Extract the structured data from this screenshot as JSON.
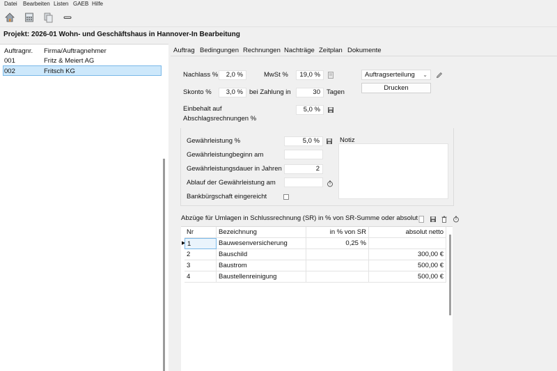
{
  "menu": {
    "items": [
      "Datei",
      "Bearbeiten",
      "Listen",
      "GAEB",
      "Hilfe"
    ]
  },
  "toolbar": {
    "icons": [
      "home-icon",
      "calculator-icon",
      "copy-icon",
      "link-icon"
    ]
  },
  "project": {
    "title": "Projekt:  2026-01 Wohn- und Geschäftshaus in Hannover-In Bearbeitung"
  },
  "contractors": {
    "columns": [
      "Auftragnr.",
      "Firma/Auftragnehmer"
    ],
    "rows": [
      {
        "nr": "001",
        "name": "Fritz & Meiert AG"
      },
      {
        "nr": "002",
        "name": "Fritsch KG"
      }
    ]
  },
  "tabs": [
    "Auftrag",
    "Bedingungen",
    "Rechnungen",
    "Nachträge",
    "Zeitplan",
    "Dokumente"
  ],
  "conditions": {
    "nachlass_label": "Nachlass %",
    "nachlass_value": "2,0 %",
    "mwst_label": "MwSt %",
    "mwst_value": "19,0 %",
    "skonto_label": "Skonto %",
    "skonto_value": "3,0 %",
    "zahlung_label": "bei Zahlung in",
    "zahlung_value": "30",
    "tage_label": "Tagen",
    "einbehalt_label_1": "Einbehalt auf",
    "einbehalt_label_2": "Abschlagsrechnungen %",
    "einbehalt_value": "5,0 %",
    "auftrag_select": "Auftragserteilung",
    "drucken_button": "Drucken"
  },
  "warranty": {
    "gewaehr_label": "Gewährleistung %",
    "gewaehr_value": "5,0 %",
    "beginn_label": "Gewährleistungbeginn am",
    "beginn_value": "",
    "dauer_label": "Gewährleistungsdauer in Jahren",
    "dauer_value": "2",
    "ablauf_label": "Ablauf der Gewährleistung am",
    "ablauf_value": "",
    "bank_label": "Bankbürgschaft eingereicht",
    "notiz_label": "Notiz",
    "notiz_value": ""
  },
  "deductions": {
    "title": "Abzüge für Umlagen in Schlussrechnung (SR) in % von SR-Summe oder absolut",
    "columns": [
      "Nr",
      "Bezeichnung",
      "in % von SR",
      "absolut netto"
    ],
    "rows": [
      {
        "nr": "1",
        "name": "Bauwesenversicherung",
        "percent": "0,25 %",
        "absolut": ""
      },
      {
        "nr": "2",
        "name": "Bauschild",
        "percent": "",
        "absolut": "300,00 €"
      },
      {
        "nr": "3",
        "name": "Baustrom",
        "percent": "",
        "absolut": "500,00 €"
      },
      {
        "nr": "4",
        "name": "Baustellenreinigung",
        "percent": "",
        "absolut": "500,00 €"
      }
    ]
  }
}
